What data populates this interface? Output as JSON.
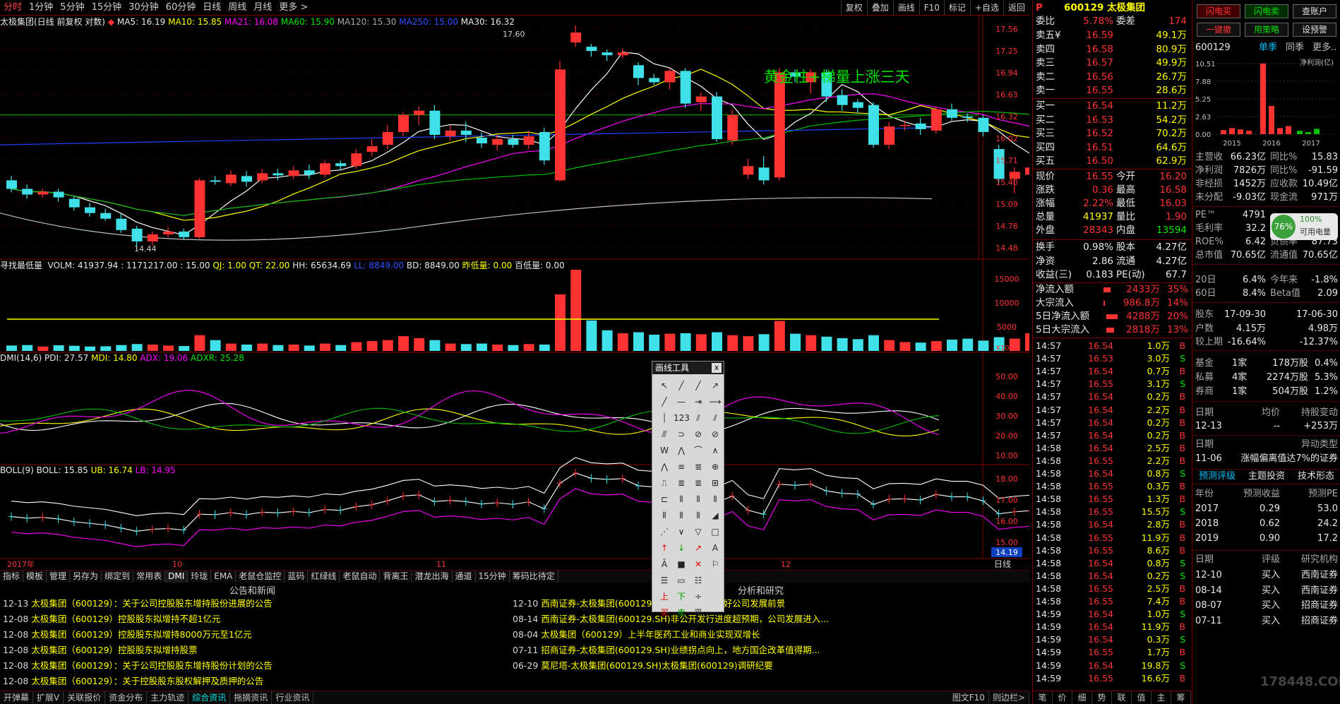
{
  "toolbar": {
    "items": [
      "分时",
      "1分钟",
      "5分钟",
      "15分钟",
      "30分钟",
      "60分钟",
      "日线",
      "周线",
      "月线",
      "更多 >"
    ],
    "right": [
      "复权",
      "叠加",
      "画线",
      "F10",
      "标记",
      "+自选",
      "返回"
    ]
  },
  "ma_line": {
    "name": "太极集团(日线 前复权 对数)",
    "ma5": "MA5: 16.19",
    "ma10": "MA10: 15.85",
    "ma21": "MA21: 16.08",
    "ma60": "MA60: 15.90",
    "ma120": "MA120: 15.30",
    "ma250": "MA250: 15.00",
    "ma30": "MA30: 16.32"
  },
  "price_axis": [
    "17.56",
    "17.25",
    "16.94",
    "16.63",
    "16.32",
    "16.02",
    "15.71",
    "15.40",
    "15.09",
    "14.78",
    "14.48"
  ],
  "annotation": "黄金柱+梯量上涨三天",
  "high_label": "17.60",
  "low_label": "14.44",
  "vol_line": {
    "name": "寻找最低量",
    "volm": "VOLM: 41937.94 : 1171217.00 : 15.00",
    "qj": "QJ: 1.00",
    "qt": "QT: 22.00",
    "hh": "HH: 65634.69",
    "ll": "LL: 8849.00",
    "bd": "BD: 8849.00",
    "zdl": "昨低量: 0.00",
    "bdl": "百低量: 0.00"
  },
  "vol_axis": [
    "15000",
    "10000",
    "5000"
  ],
  "vol_unit": "X10",
  "dmi_line": {
    "name": "DMI(14,6)",
    "pdi": "PDI: 27.57",
    "mdi": "MDI: 14.80",
    "adx": "ADX: 19.06",
    "adxr": "ADXR: 25.28"
  },
  "dmi_axis": [
    "50.00",
    "40.00",
    "30.00",
    "20.00",
    "10.00"
  ],
  "boll_line": {
    "name": "BOLL(9)",
    "boll": "BOLL: 15.85",
    "ub": "UB: 16.74",
    "lb": "LB: 14.95"
  },
  "boll_axis": [
    "18.00",
    "17.00",
    "16.00",
    "15.00"
  ],
  "boll_price": "14.19",
  "date_axis": [
    "2017年",
    "10",
    "11",
    "12"
  ],
  "date_btn": "日线",
  "bottom_tabs": [
    "指标",
    "模板",
    "管理",
    "另存为",
    "绑定到",
    "常用表",
    "DMI",
    "玲珑",
    "EMA",
    "老鼠仓监控",
    "蓝码",
    "红绿线",
    "老鼠自动",
    "背离王",
    "潜龙出海",
    "通道",
    "15分钟",
    "筹码比待定"
  ],
  "news": {
    "left_title": "公告和新闻",
    "right_title": "分析和研究",
    "left": [
      {
        "d": "12-13",
        "t": "太极集团（600129）：关于公司控股股东增持股份进展的公告"
      },
      {
        "d": "12-08",
        "t": "太极集团（600129）控股股东拟增持不超1亿元"
      },
      {
        "d": "12-08",
        "t": "太极集团（600129）控股股东拟增持8000万元至1亿元"
      },
      {
        "d": "12-08",
        "t": "太极集团（600129）控股股东拟增持股票"
      },
      {
        "d": "12-08",
        "t": "太极集团（600129）：关于公司控股股东增持股份计划的公告"
      },
      {
        "d": "12-08",
        "t": "太极集团（600129）：关于控股股东股权解押及质押的公告"
      }
    ],
    "right": [
      {
        "d": "12-10",
        "t": "西南证券-太极集团(600129.SH)股东增持，看好公司发展前景"
      },
      {
        "d": "08-14",
        "t": "西南证券-太极集团(600129.SH)非公开发行进度超预期，公司发展进入..."
      },
      {
        "d": "08-04",
        "t": "太极集团（600129）上半年医药工业和商业实现双增长"
      },
      {
        "d": "07-11",
        "t": "招商证券-太极集团(600129.SH)业绩拐点向上，地方国企改革值得期..."
      },
      {
        "d": "06-29",
        "t": "莫尼塔-太极集团(600129.SH)太极集团(600129)调研纪要"
      }
    ]
  },
  "status_tabs": [
    "开弹幕",
    "扩展V",
    "关联报价",
    "资金分布",
    "主力轨迹",
    "综合资讯",
    "拖摘资讯",
    "行业资讯"
  ],
  "status_right": [
    "图文F10",
    "则边栏>"
  ],
  "drawtool": {
    "title": "画线工具",
    "close": "x"
  },
  "quote": {
    "flag": "P",
    "code_name": "600129 太极集团",
    "wb": {
      "label1": "委比",
      "v1": "5.78%",
      "label2": "委差",
      "v2": "174"
    },
    "asks": [
      [
        "卖五¥",
        "16.59",
        "49.1万"
      ],
      [
        "卖四",
        "16.58",
        "80.9万"
      ],
      [
        "卖三",
        "16.57",
        "49.9万"
      ],
      [
        "卖二",
        "16.56",
        "26.7万"
      ],
      [
        "卖一",
        "16.55",
        "28.6万"
      ]
    ],
    "bids": [
      [
        "买一",
        "16.54",
        "11.2万"
      ],
      [
        "买二",
        "16.53",
        "54.2万"
      ],
      [
        "买三",
        "16.52",
        "70.2万"
      ],
      [
        "买四",
        "16.51",
        "64.6万"
      ],
      [
        "买五",
        "16.50",
        "62.9万"
      ]
    ],
    "stats": [
      [
        "现价",
        "16.55",
        "今开",
        "16.20"
      ],
      [
        "涨跌",
        "0.36",
        "最高",
        "16.58"
      ],
      [
        "涨幅",
        "2.22%",
        "最低",
        "16.03"
      ],
      [
        "总量",
        "41937",
        "量比",
        "1.90"
      ],
      [
        "外盘",
        "28343",
        "内盘",
        "13594"
      ],
      [
        "换手",
        "0.98%",
        "股本",
        "4.27亿"
      ],
      [
        "净资",
        "2.86",
        "流通",
        "4.27亿"
      ],
      [
        "收益(三)",
        "0.183",
        "PE(动)",
        "67.7"
      ]
    ],
    "flows": [
      [
        "净流入额",
        "2433万",
        "35%"
      ],
      [
        "大宗流入",
        "986.8万",
        "14%"
      ],
      [
        "5日净流入额",
        "4288万",
        "20%"
      ],
      [
        "5日大宗流入",
        "2818万",
        "13%"
      ]
    ],
    "ticks": [
      [
        "14:57",
        "16.54",
        "1.0万",
        "B"
      ],
      [
        "14:57",
        "16.53",
        "3.0万",
        "S"
      ],
      [
        "14:57",
        "16.54",
        "0.7万",
        "B"
      ],
      [
        "14:57",
        "16.55",
        "3.1万",
        "S"
      ],
      [
        "14:57",
        "16.54",
        "0.2万",
        "B"
      ],
      [
        "14:57",
        "16.54",
        "2.2万",
        "B"
      ],
      [
        "14:57",
        "16.54",
        "0.2万",
        "B"
      ],
      [
        "14:57",
        "16.54",
        "0.2万",
        "B"
      ],
      [
        "14:58",
        "16.54",
        "2.5万",
        "B"
      ],
      [
        "14:58",
        "16.55",
        "2.2万",
        "B"
      ],
      [
        "14:58",
        "16.54",
        "0.8万",
        "S"
      ],
      [
        "14:58",
        "16.55",
        "0.3万",
        "B"
      ],
      [
        "14:58",
        "16.55",
        "1.3万",
        "B"
      ],
      [
        "14:58",
        "16.55",
        "15.5万",
        "S"
      ],
      [
        "14:58",
        "16.54",
        "2.8万",
        "B"
      ],
      [
        "14:58",
        "16.55",
        "11.9万",
        "B"
      ],
      [
        "14:58",
        "16.55",
        "8.6万",
        "B"
      ],
      [
        "14:58",
        "16.54",
        "0.8万",
        "S"
      ],
      [
        "14:58",
        "16.54",
        "0.2万",
        "S"
      ],
      [
        "14:58",
        "16.55",
        "2.5万",
        "B"
      ],
      [
        "14:58",
        "16.55",
        "7.4万",
        "B"
      ],
      [
        "14:59",
        "16.54",
        "1.0万",
        "S"
      ],
      [
        "14:59",
        "16.54",
        "11.9万",
        "B"
      ],
      [
        "14:59",
        "16.54",
        "0.3万",
        "S"
      ],
      [
        "14:59",
        "16.55",
        "1.7万",
        "B"
      ],
      [
        "14:59",
        "16.54",
        "19.8万",
        "S"
      ],
      [
        "14:59",
        "16.55",
        "16.6万",
        "B"
      ]
    ],
    "bottom_tabs": [
      "笔",
      "价",
      "细",
      "势",
      "联",
      "值",
      "主",
      "筹"
    ]
  },
  "fund": {
    "top_btns": [
      "闪电买",
      "闪电卖",
      "查账户",
      "一键撤",
      "用策略",
      "设预警"
    ],
    "code": "600129",
    "tabs": [
      "单季",
      "同季",
      "更多.."
    ],
    "chart_label": "净利润(亿)",
    "chart_yaxis": [
      "10.51",
      "7.88",
      "5.25",
      "2.63",
      "0.00"
    ],
    "chart_years": [
      "2015",
      "2016",
      "2017"
    ],
    "rows1": [
      [
        "主营收",
        "66.23亿",
        "同比%",
        "15.83"
      ],
      [
        "净利润",
        "7826万",
        "同比%",
        "-91.59"
      ],
      [
        "非经损",
        "1452万",
        "应收款",
        "10.49亿"
      ],
      [
        "未分配",
        "-9.03亿",
        "现金流",
        "971万"
      ]
    ],
    "rows2": [
      [
        "PE™",
        "4791",
        "",
        ""
      ],
      [
        "毛利率",
        "32.2",
        "",
        ""
      ],
      [
        "ROE%",
        "6.42",
        "负债率",
        "87.73"
      ],
      [
        "总市值",
        "70.65亿",
        "流通值",
        "70.65亿"
      ]
    ],
    "badge": {
      "pct": "76%",
      "p2": "100%",
      "label": "可用电量"
    },
    "perf": [
      [
        "20日",
        "6.4%",
        "今年来",
        "-1.8%"
      ],
      [
        "60日",
        "8.4%",
        "Beta值",
        "2.09"
      ]
    ],
    "holders": [
      [
        "股东",
        "17-09-30",
        "",
        "17-06-30"
      ],
      [
        "户数",
        "4.15万",
        "",
        "4.98万"
      ],
      [
        "较上期",
        "-16.64%",
        "",
        "-12.37%"
      ]
    ],
    "inst": [
      [
        "基金",
        "1家",
        "178万股",
        "0.4%"
      ],
      [
        "私募",
        "4家",
        "2274万股",
        "5.3%"
      ],
      [
        "券商",
        "1家",
        "504万股",
        "1.2%"
      ]
    ],
    "change_hdr": [
      "日期",
      "均价",
      "持股变动"
    ],
    "change": [
      "12-13",
      "--",
      "+253万"
    ],
    "abn_hdr": [
      "日期",
      "异动类型"
    ],
    "abn": [
      "11-06",
      "涨幅偏离值达7%的证券"
    ],
    "pred_tabs": [
      "预测评级",
      "主题投资",
      "技术形态"
    ],
    "pred_hdr": [
      "年份",
      "预测收益",
      "预测PE"
    ],
    "pred": [
      [
        "2017",
        "0.29",
        "53.0"
      ],
      [
        "2018",
        "0.62",
        "24.2"
      ],
      [
        "2019",
        "0.90",
        "17.2"
      ]
    ],
    "rate_hdr": [
      "日期",
      "评级",
      "研究机构"
    ],
    "rates": [
      [
        "12-10",
        "买入",
        "西南证券"
      ],
      [
        "08-14",
        "买入",
        "西南证券"
      ],
      [
        "08-07",
        "买入",
        "招商证券"
      ],
      [
        "07-11",
        "买入",
        "招商证券"
      ]
    ],
    "watermark": "178448.COM"
  },
  "chart_data": {
    "type": "candlestick",
    "candles": [
      [
        15.42,
        15.3,
        15.48,
        15.25
      ],
      [
        15.3,
        15.22,
        15.36,
        15.16
      ],
      [
        15.22,
        15.26,
        15.3,
        15.18
      ],
      [
        15.26,
        15.18,
        15.3,
        15.12
      ],
      [
        15.16,
        15.04,
        15.2,
        14.99
      ],
      [
        15.04,
        14.96,
        15.1,
        14.91
      ],
      [
        14.96,
        14.88,
        15.02,
        14.85
      ],
      [
        14.88,
        14.72,
        14.95,
        14.68
      ],
      [
        14.74,
        14.56,
        14.78,
        14.44
      ],
      [
        14.56,
        14.66,
        14.7,
        14.5
      ],
      [
        14.66,
        14.7,
        14.76,
        14.62
      ],
      [
        14.7,
        14.62,
        14.74,
        14.58
      ],
      [
        14.62,
        15.42,
        15.45,
        14.6
      ],
      [
        15.42,
        15.4,
        15.48,
        15.36
      ],
      [
        15.38,
        15.5,
        15.56,
        15.34
      ],
      [
        15.48,
        15.4,
        15.55,
        15.33
      ],
      [
        15.42,
        15.52,
        15.58,
        15.38
      ],
      [
        15.52,
        15.49,
        15.58,
        15.42
      ],
      [
        15.48,
        15.56,
        15.62,
        15.44
      ],
      [
        15.56,
        15.5,
        15.64,
        15.44
      ],
      [
        15.5,
        15.66,
        15.7,
        15.46
      ],
      [
        15.66,
        15.62,
        15.7,
        15.57
      ],
      [
        15.62,
        15.8,
        15.86,
        15.58
      ],
      [
        15.82,
        15.9,
        16.0,
        15.76
      ],
      [
        15.92,
        16.1,
        16.2,
        15.86
      ],
      [
        16.1,
        16.34,
        16.38,
        16.04
      ],
      [
        16.34,
        16.4,
        16.46,
        16.2
      ],
      [
        16.4,
        16.06,
        16.48,
        16.0
      ],
      [
        16.04,
        16.12,
        16.2,
        15.98
      ],
      [
        16.12,
        16.06,
        16.24,
        15.96
      ],
      [
        16.02,
        15.94,
        16.1,
        15.88
      ],
      [
        15.92,
        16.0,
        16.06,
        15.84
      ],
      [
        16.0,
        15.92,
        16.06,
        15.88
      ],
      [
        15.92,
        16.04,
        16.12,
        15.86
      ],
      [
        16.1,
        15.7,
        16.16,
        15.64
      ],
      [
        15.42,
        16.98,
        17.1,
        15.4
      ],
      [
        17.36,
        17.5,
        17.6,
        17.3
      ],
      [
        17.3,
        17.24,
        17.34,
        17.16
      ],
      [
        17.22,
        17.18,
        17.26,
        17.1
      ],
      [
        17.18,
        17.22,
        17.28,
        17.14
      ],
      [
        17.04,
        16.86,
        17.08,
        16.76
      ],
      [
        16.86,
        16.8,
        16.92,
        16.76
      ],
      [
        16.8,
        16.96,
        17.0,
        16.7
      ],
      [
        16.96,
        16.5,
        17.0,
        16.44
      ],
      [
        16.52,
        16.6,
        16.66,
        16.4
      ],
      [
        16.6,
        16.0,
        16.66,
        15.96
      ],
      [
        15.98,
        16.34,
        16.42,
        15.92
      ],
      [
        15.5,
        15.62,
        15.72,
        15.44
      ],
      [
        15.6,
        15.42,
        15.76,
        15.36
      ],
      [
        15.46,
        16.94,
        17.0,
        15.42
      ],
      [
        16.94,
        16.88,
        16.98,
        16.8
      ],
      [
        16.8,
        16.94,
        16.98,
        16.64
      ],
      [
        16.94,
        16.6,
        16.98,
        16.52
      ],
      [
        16.62,
        16.48,
        16.7,
        16.4
      ],
      [
        16.52,
        16.44,
        16.56,
        16.36
      ],
      [
        16.48,
        15.92,
        16.52,
        15.88
      ],
      [
        15.92,
        16.18,
        16.24,
        15.86
      ],
      [
        16.2,
        16.2,
        16.26,
        16.12
      ],
      [
        16.22,
        16.14,
        16.3,
        16.06
      ],
      [
        16.12,
        16.42,
        16.46,
        16.08
      ],
      [
        16.42,
        16.3,
        16.5,
        16.26
      ],
      [
        16.32,
        16.3,
        16.36,
        16.24
      ],
      [
        16.3,
        16.1,
        16.34,
        16.04
      ],
      [
        15.86,
        15.44,
        15.92,
        15.38
      ],
      [
        15.44,
        15.54,
        15.6,
        15.24
      ],
      [
        15.5,
        15.6,
        15.64,
        15.46
      ],
      [
        15.56,
        15.52,
        15.62,
        15.44
      ],
      [
        15.48,
        15.42,
        15.6,
        15.36
      ],
      [
        15.46,
        15.92,
        15.96,
        15.42
      ],
      [
        16.0,
        16.04,
        16.08,
        15.92
      ],
      [
        16.02,
        16.06,
        16.12,
        15.98
      ],
      [
        16.04,
        16.1,
        16.14,
        16.0
      ],
      [
        16.08,
        16.12,
        16.16,
        16.04
      ],
      [
        16.2,
        16.55,
        16.58,
        16.03
      ]
    ],
    "volumes": [
      1100,
      1200,
      900,
      1150,
      1050,
      900,
      950,
      1200,
      1400,
      1300,
      1100,
      1000,
      3200,
      2200,
      1500,
      1300,
      1500,
      1200,
      1300,
      1100,
      1500,
      1200,
      1800,
      2000,
      2200,
      3000,
      2600,
      2200,
      1500,
      1400,
      1500,
      1300,
      1200,
      1400,
      1300,
      11500,
      16500,
      6200,
      4200,
      3600,
      3800,
      3300,
      3500,
      3600,
      3400,
      3800,
      3200,
      3000,
      3400,
      6100,
      3500,
      3200,
      2900,
      2600,
      2400,
      3200,
      2200,
      1800,
      1700,
      2000,
      2300,
      2500,
      2100,
      2800,
      2500,
      3600,
      2200,
      1800,
      2300,
      4800,
      3400,
      2600,
      2200,
      4194
    ],
    "ylim": [
      14.48,
      17.56
    ]
  }
}
